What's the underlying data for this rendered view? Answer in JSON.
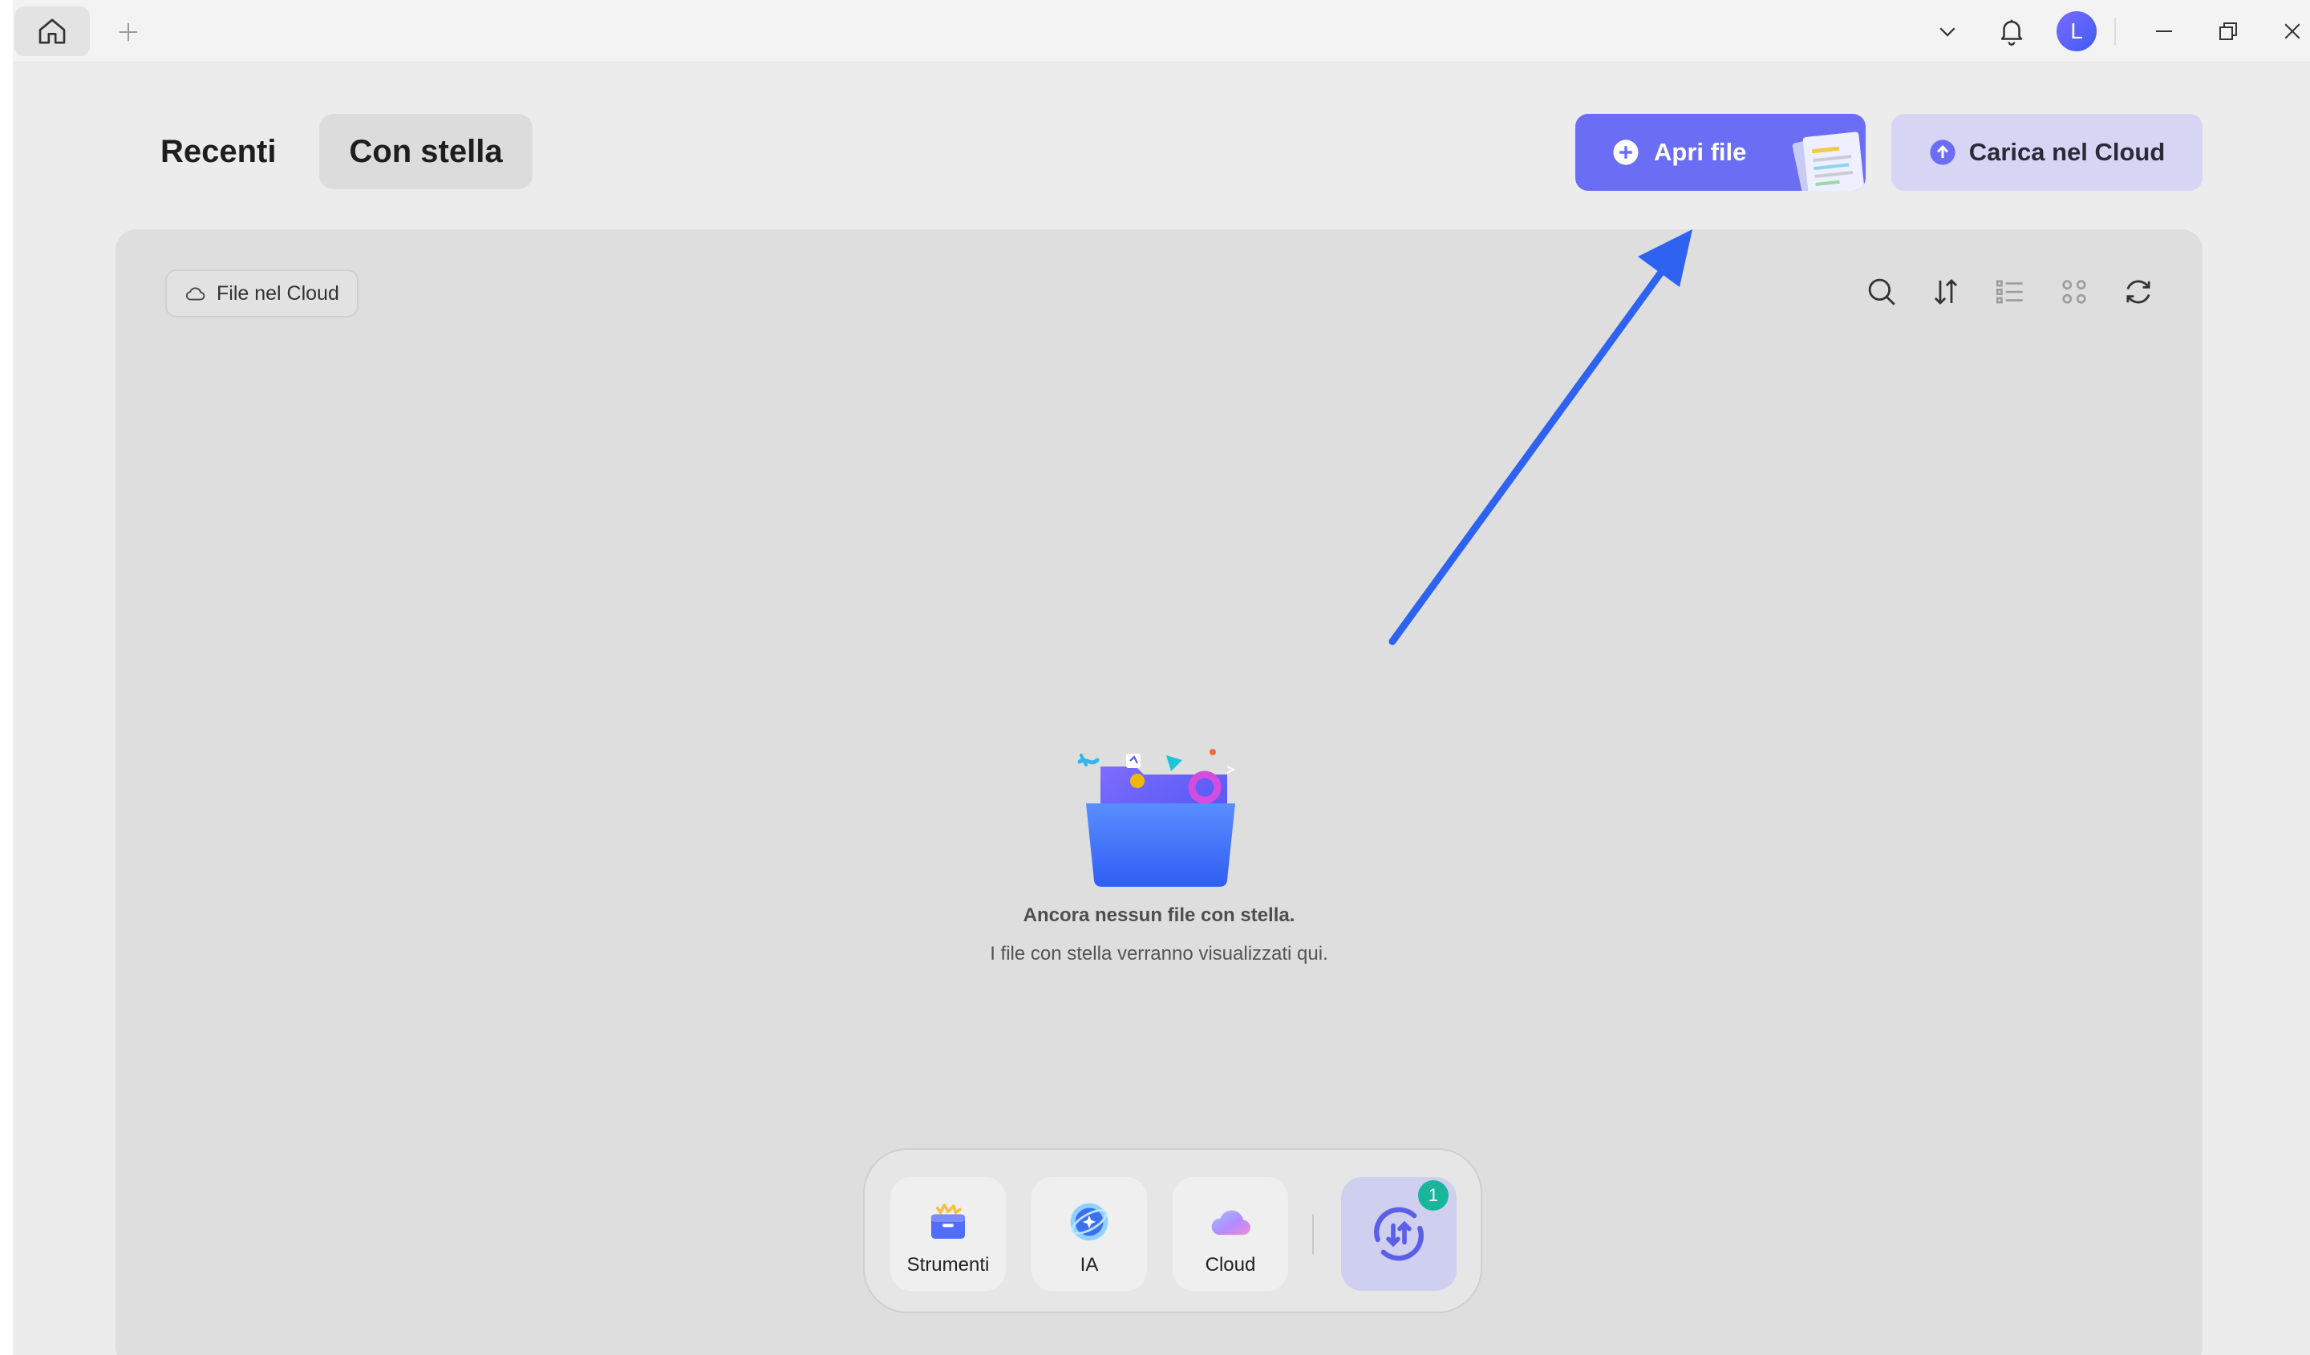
{
  "titlebar": {
    "avatar_letter": "L"
  },
  "segments": {
    "recent": "Recenti",
    "starred": "Con stella"
  },
  "actions": {
    "open_file": "Apri file",
    "upload_cloud": "Carica nel Cloud"
  },
  "panel": {
    "cloud_chip": "File nel Cloud",
    "empty_title": "Ancora nessun file con stella.",
    "empty_subtitle": "I file con stella verranno visualizzati qui."
  },
  "dock": {
    "tools": "Strumenti",
    "ai": "IA",
    "cloud": "Cloud",
    "badge_count": "1"
  },
  "colors": {
    "accent": "#6b6df5",
    "accent_soft": "#d6d6f4",
    "badge": "#19b69c",
    "arrow": "#2d63f0"
  }
}
